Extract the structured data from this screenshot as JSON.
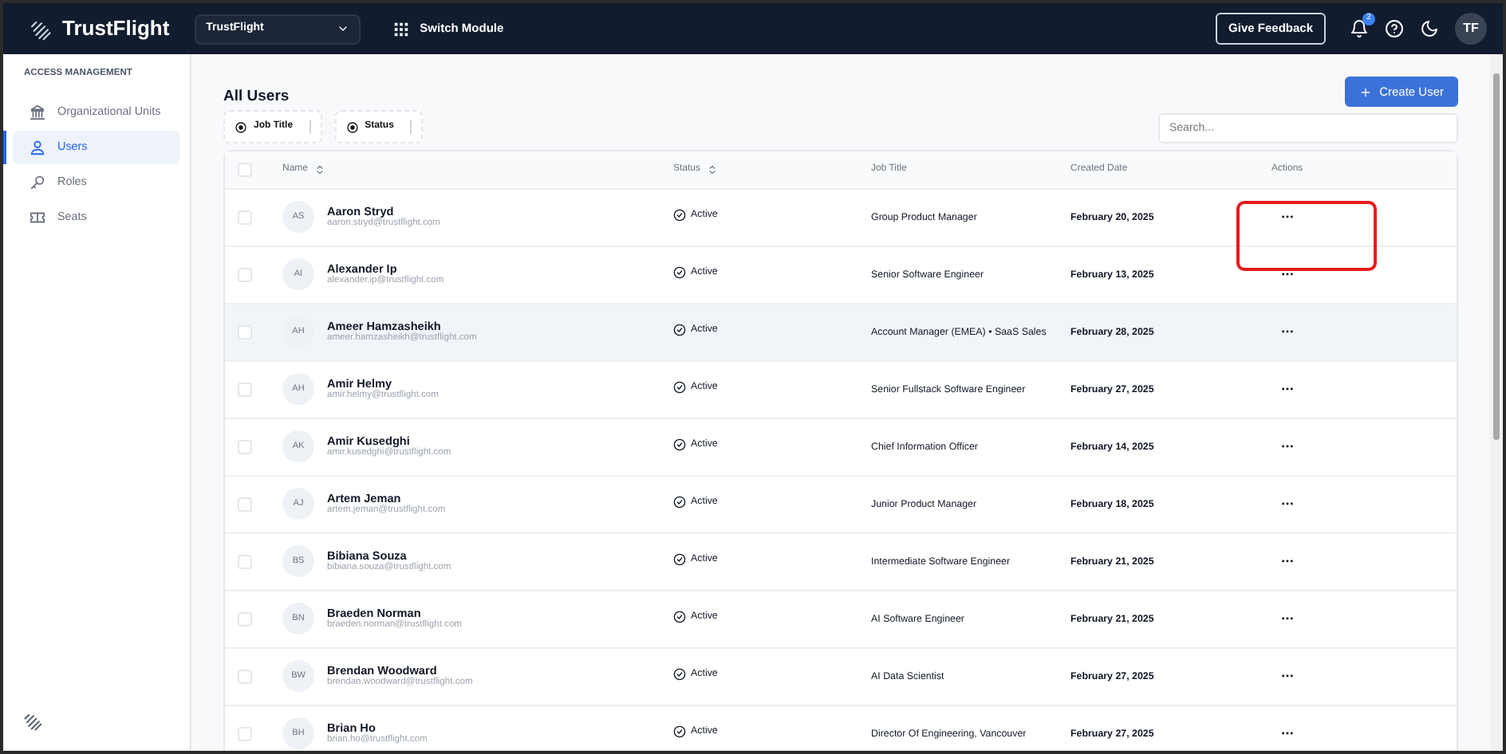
{
  "topbar": {
    "brand": "TrustFlight",
    "org_select": "TrustFlight",
    "switch_module": "Switch Module",
    "feedback": "Give Feedback",
    "notification_count": "2",
    "avatar": "TF"
  },
  "sidebar": {
    "section": "ACCESS MANAGEMENT",
    "items": [
      {
        "label": "Organizational Units",
        "selected": false
      },
      {
        "label": "Users",
        "selected": true
      },
      {
        "label": "Roles",
        "selected": false
      },
      {
        "label": "Seats",
        "selected": false
      }
    ]
  },
  "page": {
    "title": "All Users",
    "create_button": "Create User",
    "filters": [
      "Job Title",
      "Status"
    ],
    "search": {
      "placeholder": "Search..."
    }
  },
  "table": {
    "select_all_checked": false,
    "columns": [
      {
        "label": "Name",
        "sortable": true
      },
      {
        "label": "Status",
        "sortable": true
      },
      {
        "label": "Job Title",
        "sortable": false
      },
      {
        "label": "Created Date",
        "sortable": false
      },
      {
        "label": "Actions",
        "sortable": false
      }
    ],
    "rows": [
      {
        "initials": "AS",
        "name": "Aaron Stryd",
        "email": "aaron.stryd@trustflight.com",
        "status": "Active",
        "job_title": "Group Product Manager",
        "created": "February 20, 2025",
        "hovered": false,
        "annotated": true
      },
      {
        "initials": "AI",
        "name": "Alexander Ip",
        "email": "alexander.ip@trustflight.com",
        "status": "Active",
        "job_title": "Senior Software Engineer",
        "created": "February 13, 2025",
        "hovered": false,
        "annotated": false
      },
      {
        "initials": "AH",
        "name": "Ameer Hamzasheikh",
        "email": "ameer.hamzasheikh@trustflight.com",
        "status": "Active",
        "job_title": "Account Manager (EMEA) • SaaS Sales",
        "created": "February 28, 2025",
        "hovered": true,
        "annotated": false
      },
      {
        "initials": "AH",
        "name": "Amir Helmy",
        "email": "amir.helmy@trustflight.com",
        "status": "Active",
        "job_title": "Senior Fullstack Software Engineer",
        "created": "February 27, 2025",
        "hovered": false,
        "annotated": false
      },
      {
        "initials": "AK",
        "name": "Amir Kusedghi",
        "email": "amir.kusedghi@trustflight.com",
        "status": "Active",
        "job_title": "Chief Information Officer",
        "created": "February 14, 2025",
        "hovered": false,
        "annotated": false
      },
      {
        "initials": "AJ",
        "name": "Artem Jeman",
        "email": "artem.jeman@trustflight.com",
        "status": "Active",
        "job_title": "Junior Product Manager",
        "created": "February 18, 2025",
        "hovered": false,
        "annotated": false
      },
      {
        "initials": "BS",
        "name": "Bibiana Souza",
        "email": "bibiana.souza@trustflight.com",
        "status": "Active",
        "job_title": "Intermediate Software Engineer",
        "created": "February 21, 2025",
        "hovered": false,
        "annotated": false
      },
      {
        "initials": "BN",
        "name": "Braeden Norman",
        "email": "braeden.norman@trustflight.com",
        "status": "Active",
        "job_title": "AI Software Engineer",
        "created": "February 21, 2025",
        "hovered": false,
        "annotated": false
      },
      {
        "initials": "BW",
        "name": "Brendan Woodward",
        "email": "brendan.woodward@trustflight.com",
        "status": "Active",
        "job_title": "AI Data Scientist",
        "created": "February 27, 2025",
        "hovered": false,
        "annotated": false
      },
      {
        "initials": "BH",
        "name": "Brian Ho",
        "email": "brian.ho@trustflight.com",
        "status": "Active",
        "job_title": "Director Of Engineering, Vancouver",
        "created": "February 27, 2025",
        "hovered": false,
        "annotated": false
      }
    ]
  }
}
